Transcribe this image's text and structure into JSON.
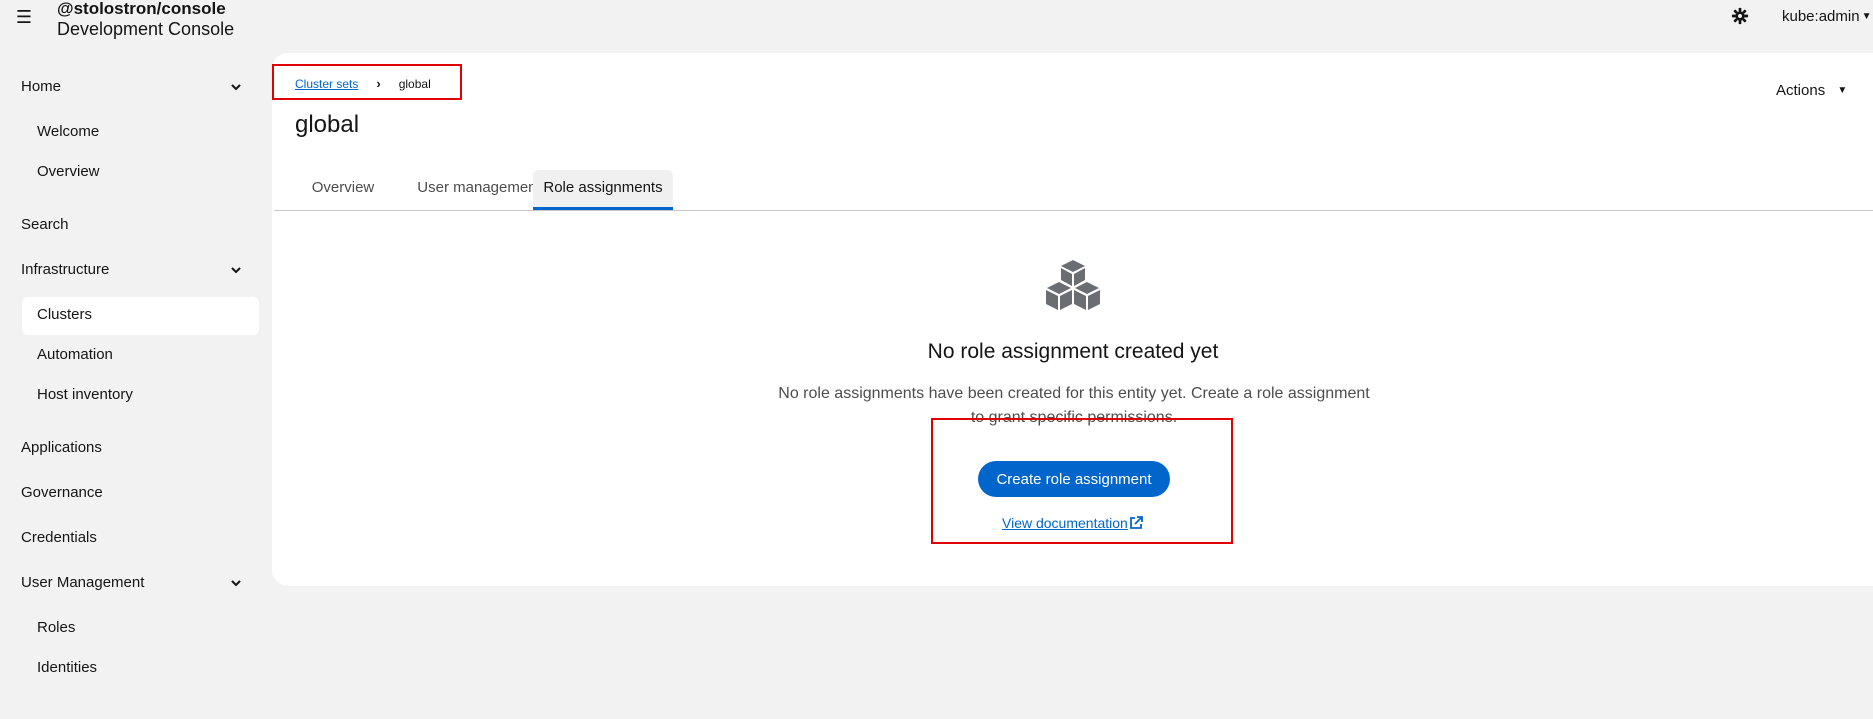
{
  "masthead": {
    "menu_icon": "hamburger-icon",
    "brand_line1": "@stolostron/console",
    "brand_line2": "Development Console",
    "settings_icon": "gear-icon",
    "user": "kube:admin"
  },
  "sidebar": {
    "home": "Home",
    "welcome": "Welcome",
    "overview": "Overview",
    "search": "Search",
    "infrastructure": "Infrastructure",
    "clusters": "Clusters",
    "automation": "Automation",
    "host_inventory": "Host inventory",
    "applications": "Applications",
    "governance": "Governance",
    "credentials": "Credentials",
    "user_management": "User Management",
    "roles": "Roles",
    "identities": "Identities"
  },
  "breadcrumb": {
    "parent": "Cluster sets",
    "current": "global"
  },
  "page": {
    "title": "global",
    "actions": "Actions"
  },
  "tabs": {
    "overview": "Overview",
    "user_management": "User management",
    "role_assignments": "Role assignments"
  },
  "empty_state": {
    "icon": "cubes-icon",
    "title": "No role assignment created yet",
    "body": "No role assignments have been created for this entity yet. Create a role assignment to grant specific permissions.",
    "primary_button": "Create role assignment",
    "doc_link": "View documentation"
  },
  "colors": {
    "accent": "#0066cc",
    "highlight_box": "#e00000",
    "page_bg": "#f2f2f2",
    "card_bg": "#ffffff"
  }
}
